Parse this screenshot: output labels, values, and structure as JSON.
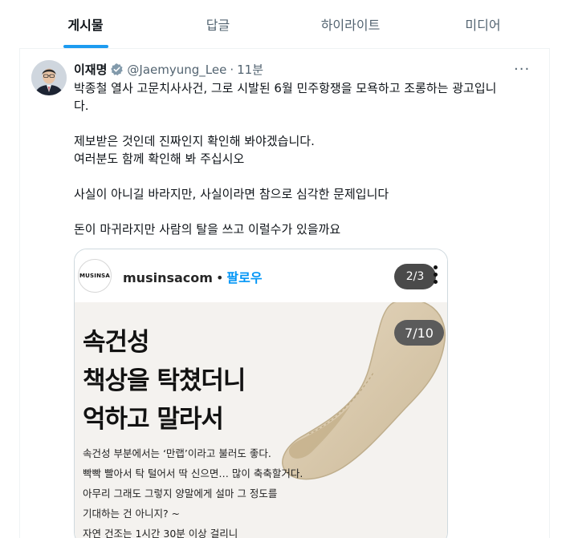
{
  "tabs": [
    {
      "label": "게시물",
      "active": true
    },
    {
      "label": "답글",
      "active": false
    },
    {
      "label": "하이라이트",
      "active": false
    },
    {
      "label": "미디어",
      "active": false
    }
  ],
  "tweet": {
    "display_name": "이재명",
    "handle": "@Jaemyung_Lee",
    "separator": "·",
    "time": "11분",
    "more_label": "···",
    "text": {
      "line1": "박종철 열사 고문치사사건, 그로 시발된 6월 민주항쟁을 모욕하고 조롱하는 광고입니",
      "line1b": "다.",
      "line2": "제보받은 것인데 진짜인지 확인해 봐야겠습니다.",
      "line3": "여러분도 함께 확인해 봐 주십시오",
      "line4": "사실이 아니길 바라지만, 사실이라면 참으로 심각한 문제입니다",
      "line5": "돈이 마귀라지만 사람의 탈을 쓰고 이럴수가 있을까요"
    }
  },
  "embedded": {
    "logo_text": "MUSINSA",
    "account": "musinsacom",
    "separator": "•",
    "follow_label": "팔로우",
    "pager_outer": "2/3",
    "pager_inner": "7/10",
    "headline": [
      "속건성",
      "책상을 탁쳤더니",
      "억하고 말라서"
    ],
    "desc": [
      "속건성 부분에서는 ‘만랩’이라고 불러도 좋다.",
      "빡빡 빨아서 탁 털어서 딱 신으면… 많이 축축할거다.",
      "아무리 그래도 그렇지 양말에게 설마 그 정도를",
      "기대하는 건 아니지? ~",
      "자연 건조는 1시간 30분 이상 걸리니"
    ]
  },
  "colors": {
    "accent": "#1d9bf0",
    "text": "#0f1419",
    "muted": "#536471",
    "verified_badge": "#829aab",
    "ad_background": "#f4f2ef",
    "sock": "#d9cab0"
  }
}
